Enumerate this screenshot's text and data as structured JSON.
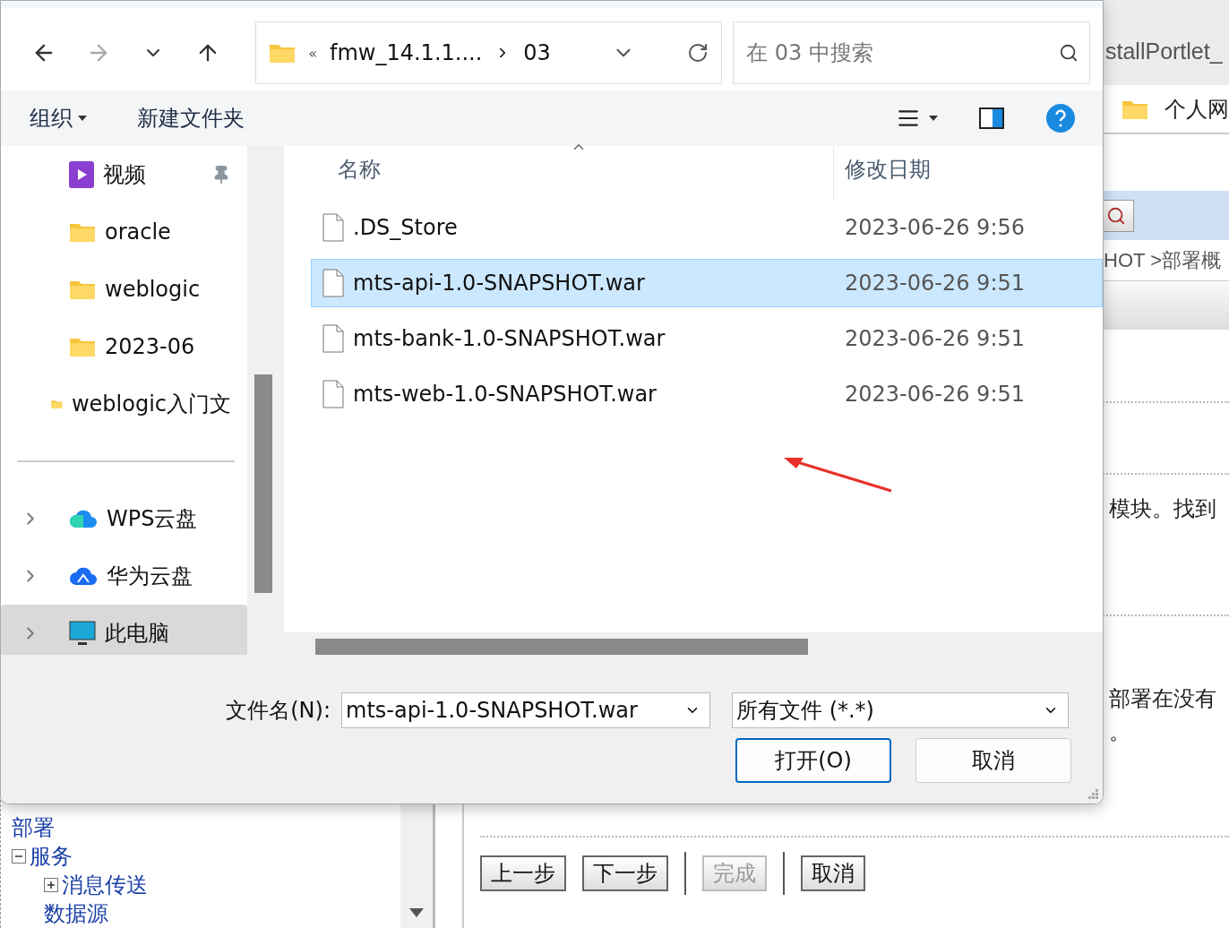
{
  "background_page": {
    "browser_tab": "stallPortlet_",
    "bookmark": "个人网",
    "breadcrumb": "HOT >部署概",
    "paragraphs": [
      "模块。找到",
      "部署在没有",
      "。"
    ],
    "tree": [
      {
        "label": "部署"
      },
      {
        "label": "服务",
        "expanded": true,
        "children": [
          {
            "label": "消息传送",
            "expanded": false
          },
          {
            "label": "数据源"
          }
        ]
      }
    ],
    "buttons": [
      {
        "label": "上一步",
        "disabled": false
      },
      {
        "label": "下一步",
        "disabled": false
      },
      {
        "label": "完成",
        "disabled": true
      },
      {
        "label": "取消",
        "disabled": false
      }
    ]
  },
  "dialog": {
    "nav_buttons": [
      {
        "kind": "back",
        "disabled": false
      },
      {
        "kind": "forward",
        "disabled": true
      },
      {
        "kind": "recent",
        "disabled": false
      },
      {
        "kind": "up",
        "disabled": false
      }
    ],
    "address": {
      "overflow": "«",
      "path": [
        "fmw_14.1.1....",
        "03"
      ]
    },
    "search": {
      "placeholder": "在 03 中搜索"
    },
    "toolbar": [
      {
        "label": "组织",
        "kind": "menu"
      },
      {
        "label": "新建文件夹",
        "kind": "button"
      }
    ],
    "nav_pane": [
      {
        "label": "视频",
        "kind": "video",
        "pinned": true,
        "selected": false
      },
      {
        "label": "oracle",
        "kind": "folder",
        "selected": false
      },
      {
        "label": "weblogic",
        "kind": "folder",
        "selected": false
      },
      {
        "label": "2023-06",
        "kind": "folder",
        "selected": false
      },
      {
        "label": "weblogic入门文",
        "kind": "folder",
        "selected": false
      },
      {
        "kind": "divider"
      },
      {
        "label": "WPS云盘",
        "kind": "cloud-wps",
        "selected": false
      },
      {
        "label": "华为云盘",
        "kind": "cloud-huawei",
        "selected": false
      },
      {
        "label": "此电脑",
        "kind": "pc",
        "selected": true
      }
    ],
    "file_list": {
      "columns": [
        "名称",
        "修改日期"
      ],
      "rows": [
        {
          "name": ".DS_Store",
          "modified": "2023-06-26 9:56",
          "selected": false
        },
        {
          "name": "mts-api-1.0-SNAPSHOT.war",
          "modified": "2023-06-26 9:51",
          "selected": true
        },
        {
          "name": "mts-bank-1.0-SNAPSHOT.war",
          "modified": "2023-06-26 9:51",
          "selected": false
        },
        {
          "name": "mts-web-1.0-SNAPSHOT.war",
          "modified": "2023-06-26 9:51",
          "selected": false
        }
      ]
    },
    "footer": {
      "filename_label": "文件名(N):",
      "filename": "mts-api-1.0-SNAPSHOT.war",
      "filter": "所有文件 (*.*)",
      "buttons": [
        {
          "label": "打开(O)",
          "kind": "primary"
        },
        {
          "label": "取消",
          "kind": "secondary"
        }
      ]
    }
  }
}
